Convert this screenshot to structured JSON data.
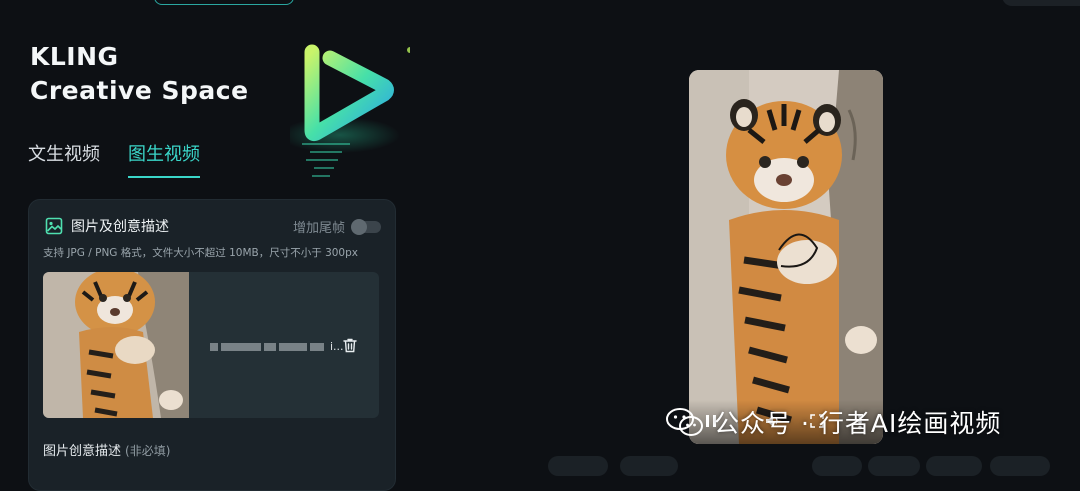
{
  "brand": {
    "line1": "KLING",
    "line2": "Creative Space"
  },
  "tabs": [
    {
      "label": "文生视频",
      "active": false
    },
    {
      "label": "图生视频",
      "active": true
    }
  ],
  "panel": {
    "title": "图片及创意描述",
    "toggle_label": "增加尾帧",
    "toggle_on": false,
    "hint": "支持 JPG / PNG 格式，文件大小不超过 10MB，尺寸不小于 300px",
    "file_name_suffix": "i...",
    "description_label": "图片创意描述",
    "description_optional": "(非必填)"
  },
  "watermark": {
    "text": "公众号 · 行者AI绘画视频"
  },
  "colors": {
    "accent": "#3ad6c9",
    "panel_bg": "#1a2228",
    "page_bg": "#0d1014"
  },
  "icons": {
    "panel_title": "image-icon",
    "trash": "trash-icon",
    "pause": "pause-icon",
    "volume": "volume-icon",
    "fullscreen": "fullscreen-icon",
    "more": "more-vertical-icon",
    "watermark": "wechat-icon"
  }
}
